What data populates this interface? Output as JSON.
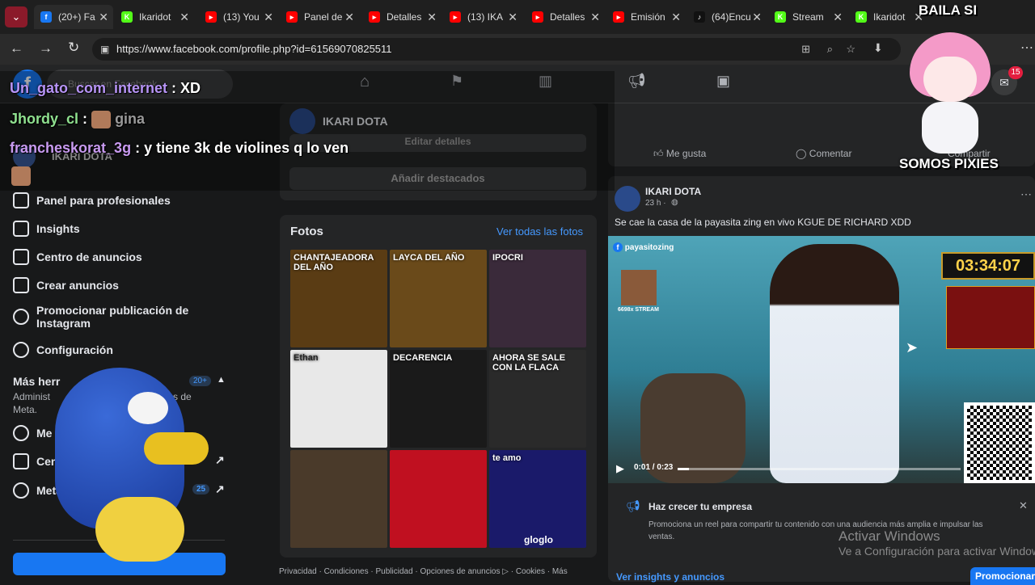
{
  "browser": {
    "tabs": [
      {
        "label": "(20+) Fa",
        "icon": "facebook-icon",
        "color": "#1877f2",
        "glyph": "f"
      },
      {
        "label": "Ikaridot",
        "icon": "kick-icon",
        "color": "#53fc18",
        "glyph": "K"
      },
      {
        "label": "(13) You",
        "icon": "youtube-icon",
        "color": "#ff0000",
        "glyph": "▸"
      },
      {
        "label": "Panel de",
        "icon": "youtube-icon",
        "color": "#ff0000",
        "glyph": "▸"
      },
      {
        "label": "Detalles",
        "icon": "youtube-icon",
        "color": "#ff0000",
        "glyph": "▸"
      },
      {
        "label": "(13) IKA",
        "icon": "youtube-icon",
        "color": "#ff0000",
        "glyph": "▸"
      },
      {
        "label": "Detalles",
        "icon": "youtube-icon",
        "color": "#ff0000",
        "glyph": "▸"
      },
      {
        "label": "Emisión",
        "icon": "youtube-icon",
        "color": "#ff0000",
        "glyph": "▸"
      },
      {
        "label": "(64)Encu",
        "icon": "tiktok-icon",
        "color": "#111111",
        "glyph": "♪"
      },
      {
        "label": "Stream",
        "icon": "kick-icon",
        "color": "#53fc18",
        "glyph": "K"
      },
      {
        "label": "Ikaridot",
        "icon": "kick-icon",
        "color": "#53fc18",
        "glyph": "K"
      }
    ],
    "url": "https://www.facebook.com/profile.php?id=61569070825511"
  },
  "facebook": {
    "search_placeholder": "Buscar en Facebook",
    "profile_name": "IKARI DOTA",
    "edit_details": "Editar detalles",
    "add_featured": "Añadir destacados",
    "notification_count": "15",
    "left_nav": [
      {
        "label": "Panel para profesionales",
        "icon": "dashboard-icon"
      },
      {
        "label": "Insights",
        "icon": "insights-icon"
      },
      {
        "label": "Centro de anuncios",
        "icon": "megaphone-icon"
      },
      {
        "label": "Crear anuncios",
        "icon": "edit-icon"
      },
      {
        "label": "Promocionar publicación de Instagram",
        "icon": "instagram-icon"
      },
      {
        "label": "Configuración",
        "icon": "gear-icon"
      }
    ],
    "more_tools": {
      "title": "Más herr",
      "badge": "20+",
      "desc_left": "Administ",
      "desc_right": "ciones de",
      "desc_line2": "Meta.",
      "items": [
        {
          "label": "Me",
          "icon": "check-circle-icon"
        },
        {
          "label": "Cen",
          "suffix": "ales",
          "icon": "people-icon"
        },
        {
          "label": "Meta",
          "badge": "25",
          "icon": "meta-icon"
        }
      ]
    },
    "photos": {
      "title": "Fotos",
      "see_all": "Ver todas las fotos",
      "thumbs": [
        {
          "caption": "CHANTAJEADORA DEL AÑO",
          "bg": "#5a3c14"
        },
        {
          "caption": "LAYCA DEL AÑO",
          "bg": "#6a4a1a"
        },
        {
          "caption": "IPOCRI",
          "bg": "#3a2a3a"
        },
        {
          "caption": "Ethan",
          "bg": "#e8e8e8"
        },
        {
          "caption": "DECARENCIA",
          "bg": "#1a1a1a"
        },
        {
          "caption": "AHORA SE SALE CON LA FLACA",
          "bg": "#2a2a2a"
        },
        {
          "caption": "",
          "bg": "#4a3a2a"
        },
        {
          "caption": "",
          "bg": "#c01020"
        },
        {
          "caption": "te amo",
          "bg": "#1a1a6a"
        }
      ],
      "overlay_text": "gloglo"
    },
    "footer_links": "Privacidad · Condiciones · Publicidad · Opciones de anuncios ▷ · Cookies · Más",
    "post_actions": {
      "like": "Me gusta",
      "comment": "Comentar",
      "share": "Compartir"
    },
    "post": {
      "author": "IKARI DOTA",
      "time": "23 h · ",
      "text": "Se cae la casa de la payasita zing en vivo KGUE DE RICHARD XDD",
      "video_channel": "payasitozing",
      "video_timer": "03:34:07",
      "video_progress": "0:01 / 0:23",
      "video_progress_fraction": 0.04,
      "emote_label": "6698x STREAM"
    },
    "promo": {
      "title": "Haz crecer tu empresa",
      "text": "Promociona un reel para compartir tu contenido con una audiencia más amplia e impulsar las ventas."
    },
    "insights_link": "Ver insights y anuncios",
    "promote_button": "Promocionar"
  },
  "windows_watermark": {
    "line1": "Activar Windows",
    "line2": "Ve a Configuración para activar Windows."
  },
  "overlay": {
    "chat": [
      {
        "user": "Un_gato_com_internet",
        "msg": " : XD"
      },
      {
        "user": "Jhordy_cl",
        "msg": " : ",
        "tail": "gina"
      },
      {
        "user": "francheskorat_3g",
        "msg": " : y tiene 3k de violines q lo ven"
      }
    ],
    "sticker_top": "BAILA SI",
    "sticker_bottom": "SOMOS PIXIES"
  }
}
